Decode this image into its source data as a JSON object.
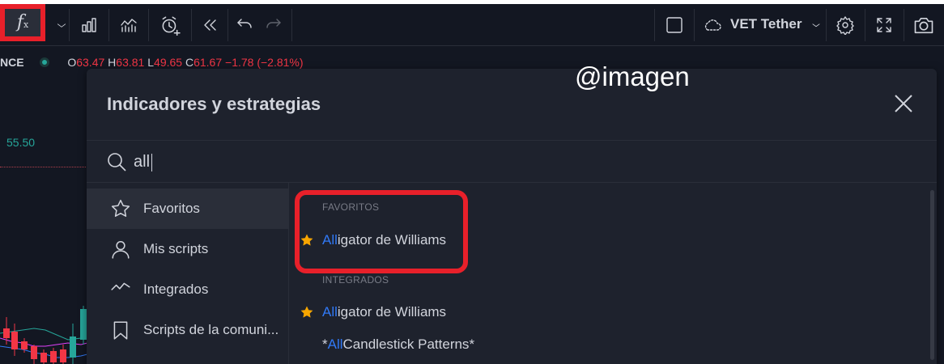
{
  "toolbar": {
    "indicators_icon": "function-icon",
    "symbol": "VET Tether",
    "icons": [
      "function-icon",
      "chevron-down-icon",
      "bar-chart-icon",
      "indicator-templates-icon",
      "alert-icon",
      "replay-icon",
      "undo-icon",
      "redo-icon",
      "layout-icon",
      "cloud-icon",
      "chevron-down-icon",
      "gear-icon",
      "fullscreen-icon",
      "camera-icon"
    ]
  },
  "chart": {
    "symbol_tail": "NCE",
    "legend": {
      "o_label": "O",
      "o_value": "63.47",
      "h_label": "H",
      "h_value": "63.81",
      "l_label": "L",
      "l_value": "49.65",
      "c_label": "C",
      "c_value": "61.67",
      "change": "−1.78 (−2.81%)"
    },
    "price_level": "55.50",
    "colors": {
      "up": "#26a69a",
      "down": "#f23645",
      "background": "#131722"
    }
  },
  "watermark": "@imagen",
  "dialog": {
    "title": "Indicadores y estrategias",
    "search": {
      "value": "all",
      "placeholder": ""
    },
    "sidebar": [
      {
        "label": "Favoritos",
        "icon": "star-outline-icon",
        "active": true
      },
      {
        "label": "Mis scripts",
        "icon": "user-icon",
        "active": false
      },
      {
        "label": "Integrados",
        "icon": "chart-icon",
        "active": false
      },
      {
        "label": "Scripts de la comuni...",
        "icon": "bookmark-icon",
        "active": false
      }
    ],
    "sections": {
      "favorites_header": "FAVORITOS",
      "builtin_header": "INTEGRADOS"
    },
    "results": [
      {
        "highlight": "All",
        "rest": "igator de Williams",
        "prefix": "",
        "suffix": "",
        "starred": true
      },
      {
        "highlight": "All",
        "rest": "igator de Williams",
        "prefix": "",
        "suffix": "",
        "starred": true
      },
      {
        "highlight": "All",
        "rest": " Candlestick Patterns",
        "prefix": "*",
        "suffix": "*",
        "starred": false
      }
    ],
    "colors": {
      "highlight": "#3179f5",
      "star": "#f7a600",
      "annotation": "#e8202a"
    }
  }
}
